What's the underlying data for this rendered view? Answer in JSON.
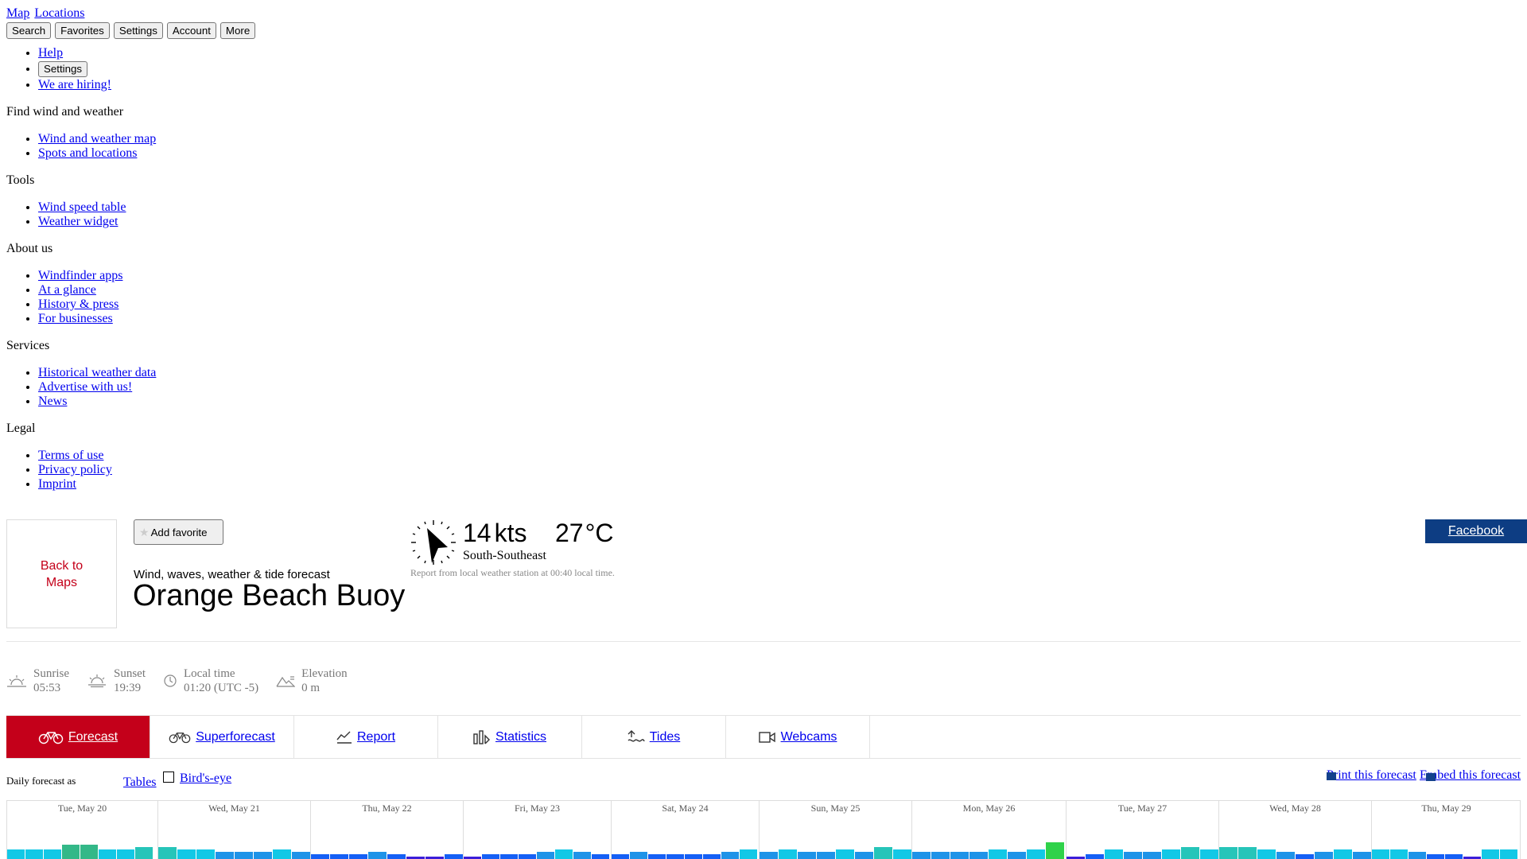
{
  "top_links": [
    "Map",
    "Locations"
  ],
  "top_buttons": [
    "Search",
    "Favorites",
    "Settings",
    "Account",
    "More"
  ],
  "utility": {
    "help": "Help",
    "settings": "Settings",
    "hiring": "We are hiring!"
  },
  "menu": [
    {
      "title": "Find wind and weather",
      "items": [
        "Wind and weather map",
        "Spots and locations"
      ]
    },
    {
      "title": "Tools",
      "items": [
        "Wind speed table",
        "Weather widget"
      ]
    },
    {
      "title": "About us",
      "items": [
        "Windfinder apps",
        "At a glance",
        "History & press",
        "For businesses"
      ]
    },
    {
      "title": "Services",
      "items": [
        "Historical weather data",
        "Advertise with us!",
        "News"
      ]
    },
    {
      "title": "Legal",
      "items": [
        "Terms of use",
        "Privacy policy",
        "Imprint"
      ]
    }
  ],
  "header": {
    "back_line1": "Back to",
    "back_line2": "Maps",
    "add_favorite": "Add favorite",
    "subtitle": "Wind, waves, weather & tide forecast",
    "title": "Orange Beach Buoy"
  },
  "current": {
    "wind_speed": "14",
    "wind_unit": "kts",
    "temperature": "27",
    "temp_unit": "°C",
    "direction": "South-Southeast",
    "report": "Report from local weather station at 00:40 local time."
  },
  "social": {
    "facebook": "Facebook"
  },
  "info": [
    {
      "icon": "sunrise-icon",
      "label": "Sunrise",
      "value": "05:53"
    },
    {
      "icon": "sunset-icon",
      "label": "Sunset",
      "value": "19:39"
    },
    {
      "icon": "clock-icon",
      "label": "Local time",
      "value": "01:20 (UTC -5)"
    },
    {
      "icon": "elevation-icon",
      "label": "Elevation",
      "value": "0 m"
    }
  ],
  "tabs": [
    {
      "label": "Forecast",
      "icon": "bicycle-icon",
      "active": true
    },
    {
      "label": "Superforecast",
      "icon": "bicycle-icon",
      "active": false
    },
    {
      "label": "Report",
      "icon": "chart-line-icon",
      "active": false
    },
    {
      "label": "Statistics",
      "icon": "statistics-icon",
      "active": false
    },
    {
      "label": "Tides",
      "icon": "tides-icon",
      "active": false
    },
    {
      "label": "Webcams",
      "icon": "webcam-icon",
      "active": false
    }
  ],
  "forecast_controls": {
    "daily_label": "Daily forecast as",
    "tables": "Tables",
    "birds_eye": "Bird's-eye",
    "print": "Print this forecast",
    "embed": "Embed this forecast"
  },
  "days": [
    "Tue, May 20",
    "Wed, May 21",
    "Thu, May 22",
    "Fri, May 23",
    "Sat, May 24",
    "Sun, May 25",
    "Mon, May 26",
    "Tue, May 27",
    "Wed, May 28",
    "Thu, May 29"
  ],
  "colors": {
    "accent": "#c4001a",
    "facebook": "#0d3d83",
    "wind_scale": [
      "#3b1ed9",
      "#1560f5",
      "#1e93e8",
      "#12c8e6",
      "#26c5b9",
      "#33b888",
      "#2fd24a"
    ]
  }
}
